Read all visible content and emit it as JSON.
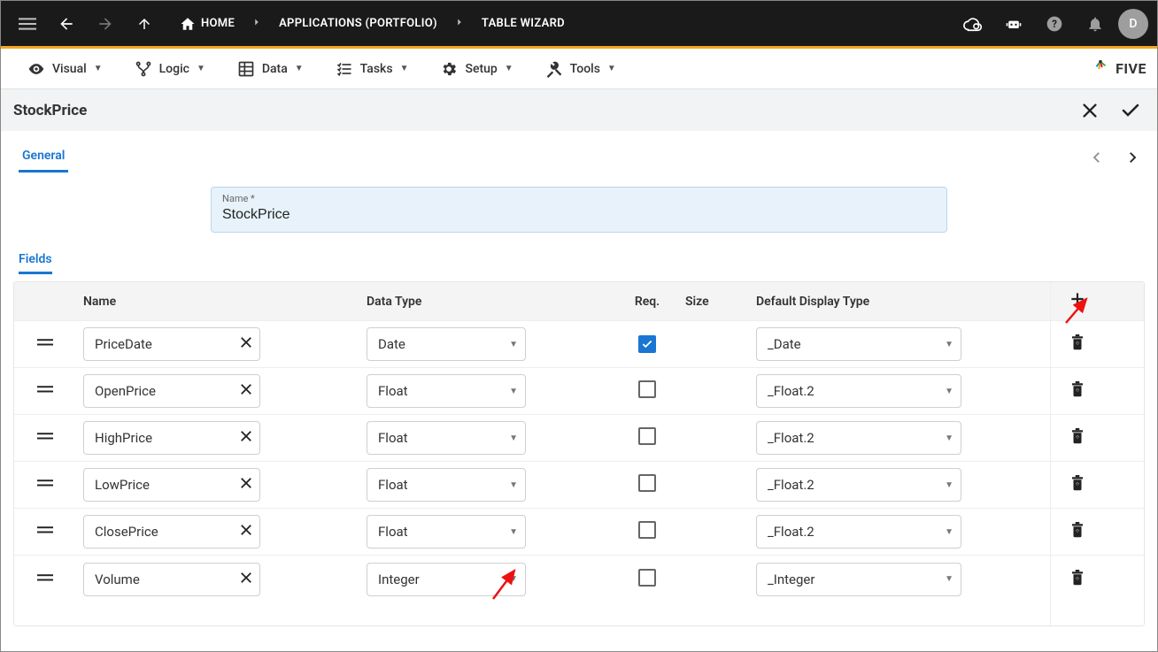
{
  "breadcrumbs": {
    "home": "HOME",
    "applications": "APPLICATIONS (PORTFOLIO)",
    "wizard": "TABLE WIZARD"
  },
  "avatar_letter": "D",
  "menubar": {
    "visual": "Visual",
    "logic": "Logic",
    "data": "Data",
    "tasks": "Tasks",
    "setup": "Setup",
    "tools": "Tools"
  },
  "brand_text": "FIVE",
  "page_title": "StockPrice",
  "section_tab_general": "General",
  "name_field_label": "Name *",
  "name_field_value": "StockPrice",
  "fields_section_label": "Fields",
  "columns": {
    "name": "Name",
    "type": "Data Type",
    "req": "Req.",
    "size": "Size",
    "display": "Default Display Type"
  },
  "rows": [
    {
      "name": "PriceDate",
      "type": "Date",
      "required": true,
      "size": "",
      "display": "_Date"
    },
    {
      "name": "OpenPrice",
      "type": "Float",
      "required": false,
      "size": "",
      "display": "_Float.2"
    },
    {
      "name": "HighPrice",
      "type": "Float",
      "required": false,
      "size": "",
      "display": "_Float.2"
    },
    {
      "name": "LowPrice",
      "type": "Float",
      "required": false,
      "size": "",
      "display": "_Float.2"
    },
    {
      "name": "ClosePrice",
      "type": "Float",
      "required": false,
      "size": "",
      "display": "_Float.2"
    },
    {
      "name": "Volume",
      "type": "Integer",
      "required": false,
      "size": "",
      "display": "_Integer"
    }
  ]
}
